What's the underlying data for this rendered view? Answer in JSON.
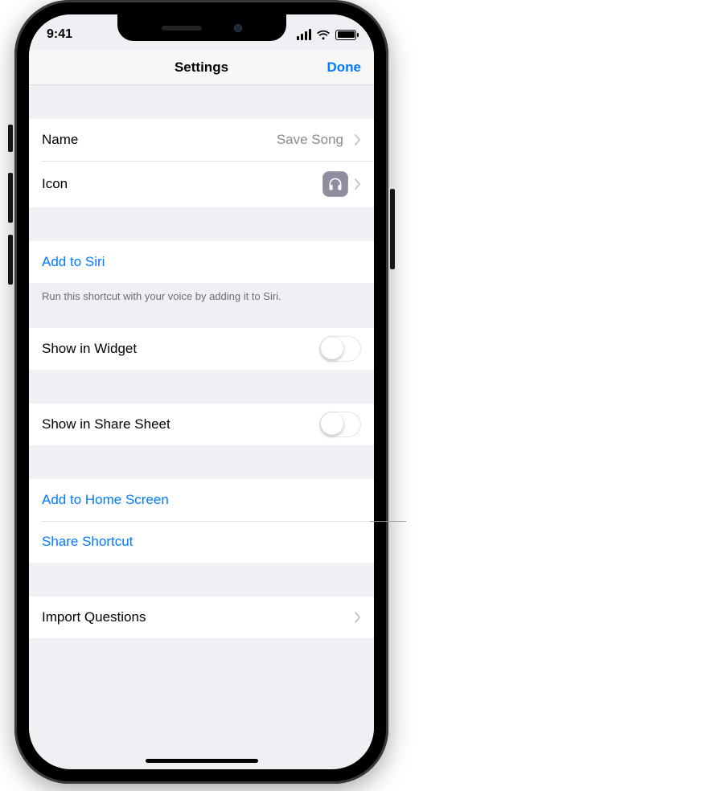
{
  "status": {
    "time": "9:41"
  },
  "nav": {
    "title": "Settings",
    "done": "Done"
  },
  "rows": {
    "name_label": "Name",
    "name_value": "Save Song",
    "icon_label": "Icon",
    "add_to_siri": "Add to Siri",
    "siri_footer": "Run this shortcut with your voice by adding it to Siri.",
    "show_in_widget": "Show in Widget",
    "show_in_share_sheet": "Show in Share Sheet",
    "add_to_home": "Add to Home Screen",
    "share_shortcut": "Share Shortcut",
    "import_questions": "Import Questions"
  },
  "toggles": {
    "show_in_widget": false,
    "show_in_share_sheet": false
  },
  "shortcut_icon": {
    "glyph": "headphones",
    "tile_color": "#8e8ea0"
  },
  "accent_color": "#007aff"
}
